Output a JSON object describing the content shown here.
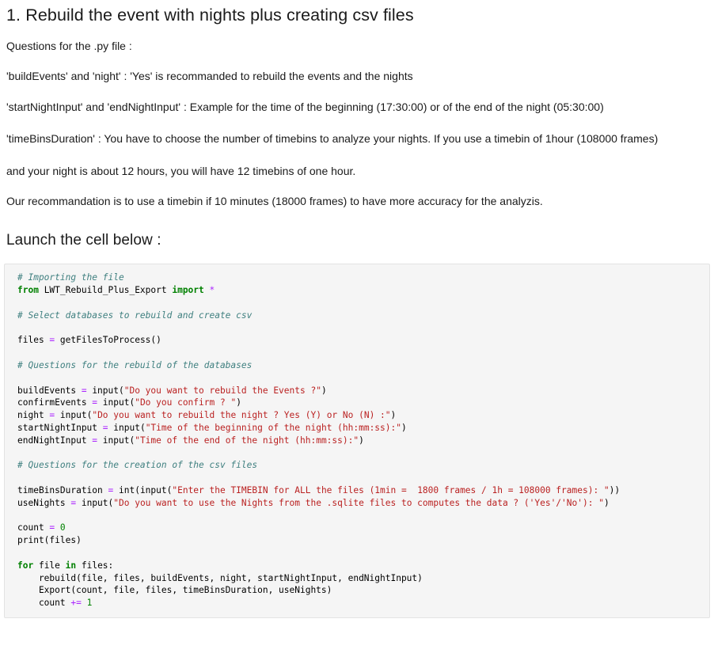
{
  "document": {
    "title": "1. Rebuild the event with nights plus creating csv files",
    "paragraphs": [
      "Questions for the .py file :",
      "'buildEvents' and 'night' : 'Yes' is recommanded to rebuild the events and the nights",
      "'startNightInput' and 'endNightInput' : Example for the time of the beginning (17:30:00) or of the end of the night (05:30:00)",
      "'timeBinsDuration' : You have to choose the number of timebins to analyze your nights. If you use a timebin of 1hour (108000 frames)",
      "and your night is about 12 hours, you will have 12 timebins of one hour.",
      "Our recommandation is to use a timebin if 10 minutes (18000 frames) to have more accuracy for the analyzis."
    ],
    "launch_heading": "Launch the cell below :"
  },
  "code_cell": {
    "language": "python",
    "lines": [
      [
        [
          "c",
          "# Importing the file"
        ]
      ],
      [
        [
          "k",
          "from"
        ],
        [
          "n",
          " LWT_Rebuild_Plus_Export "
        ],
        [
          "k",
          "import"
        ],
        [
          "n",
          " "
        ],
        [
          "o",
          "*"
        ]
      ],
      [],
      [
        [
          "c",
          "# Select databases to rebuild and create csv"
        ]
      ],
      [],
      [
        [
          "n",
          "files "
        ],
        [
          "o",
          "="
        ],
        [
          "n",
          " getFilesToProcess()"
        ]
      ],
      [],
      [
        [
          "c",
          "# Questions for the rebuild of the databases"
        ]
      ],
      [],
      [
        [
          "n",
          "buildEvents "
        ],
        [
          "o",
          "="
        ],
        [
          "n",
          " input("
        ],
        [
          "s",
          "\"Do you want to rebuild the Events ?\""
        ],
        [
          "n",
          ")"
        ]
      ],
      [
        [
          "n",
          "confirmEvents "
        ],
        [
          "o",
          "="
        ],
        [
          "n",
          " input("
        ],
        [
          "s",
          "\"Do you confirm ? \""
        ],
        [
          "n",
          ")"
        ]
      ],
      [
        [
          "n",
          "night "
        ],
        [
          "o",
          "="
        ],
        [
          "n",
          " input("
        ],
        [
          "s",
          "\"Do you want to rebuild the night ? Yes (Y) or No (N) :\""
        ],
        [
          "n",
          ")"
        ]
      ],
      [
        [
          "n",
          "startNightInput "
        ],
        [
          "o",
          "="
        ],
        [
          "n",
          " input("
        ],
        [
          "s",
          "\"Time of the beginning of the night (hh:mm:ss):\""
        ],
        [
          "n",
          ")"
        ]
      ],
      [
        [
          "n",
          "endNightInput "
        ],
        [
          "o",
          "="
        ],
        [
          "n",
          " input("
        ],
        [
          "s",
          "\"Time of the end of the night (hh:mm:ss):\""
        ],
        [
          "n",
          ")"
        ]
      ],
      [],
      [
        [
          "c",
          "# Questions for the creation of the csv files"
        ]
      ],
      [],
      [
        [
          "n",
          "timeBinsDuration "
        ],
        [
          "o",
          "="
        ],
        [
          "n",
          " int(input("
        ],
        [
          "s",
          "\"Enter the TIMEBIN for ALL the files (1min =  1800 frames / 1h = 108000 frames): \""
        ],
        [
          "n",
          "))"
        ]
      ],
      [
        [
          "n",
          "useNights "
        ],
        [
          "o",
          "="
        ],
        [
          "n",
          " input("
        ],
        [
          "s",
          "\"Do you want to use the Nights from the .sqlite files to computes the data ? ('Yes'/'No'): \""
        ],
        [
          "n",
          ")"
        ]
      ],
      [],
      [
        [
          "n",
          "count "
        ],
        [
          "o",
          "="
        ],
        [
          "n",
          " "
        ],
        [
          "m",
          "0"
        ]
      ],
      [
        [
          "n",
          "print(files)"
        ]
      ],
      [],
      [
        [
          "k",
          "for"
        ],
        [
          "n",
          " file "
        ],
        [
          "k",
          "in"
        ],
        [
          "n",
          " files:"
        ]
      ],
      [
        [
          "n",
          "    rebuild(file, files, buildEvents, night, startNightInput, endNightInput)"
        ]
      ],
      [
        [
          "n",
          "    Export(count, file, files, timeBinsDuration, useNights)"
        ]
      ],
      [
        [
          "n",
          "    count "
        ],
        [
          "o",
          "+="
        ],
        [
          "n",
          " "
        ],
        [
          "m",
          "1"
        ]
      ]
    ]
  },
  "colors": {
    "comment": "#408080",
    "keyword": "#008000",
    "string": "#ba2121",
    "operator": "#aa22ff",
    "number": "#008000",
    "cell_background": "#f5f5f5",
    "cell_border": "#e3e3e3",
    "text": "#1a1a1a"
  }
}
